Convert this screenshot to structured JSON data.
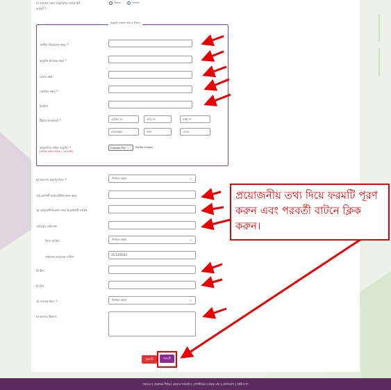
{
  "colors": {
    "accent": "#8c3b94",
    "annotation": "#e60000",
    "footer": "#5c2a5f",
    "prev_button": "#e0303b",
    "next_button": "#8b2c8f"
  },
  "question": {
    "label": "ঢ) বর্তমানে কোন অনুমতিপত্র আছে কি?",
    "label_cont": "আছে? *",
    "options": [
      "নিবন্ধন",
      "প্রযোজ্য"
    ],
    "selected_index": 1
  },
  "fieldset": {
    "legend": "অনুমতি সংক্রান্ত তথ্য ও ঠিকানা",
    "fields": [
      {
        "label": "জাতীয় পরিচয়পত্র নম্বর: *",
        "value": ""
      },
      {
        "label": "অনুমতি প্রদানের নম্বর: *",
        "value": ""
      },
      {
        "label": "রেফার নম্বর:",
        "value": ""
      },
      {
        "label": "মোবাইল নম্বর: *",
        "value": ""
      },
      {
        "label": "ইমেইল:",
        "value": ""
      }
    ],
    "address": {
      "label": "ঠিকানা (বর্তমান): *",
      "placeholders": [
        "হোল্ডিং নং",
        "বাড়ি নং",
        "রাস্তা নং",
        "গ্রাম/মহল্লা",
        "থানা",
        "জেলা"
      ]
    },
    "file": {
      "label": "অনুমোদিত ফাইল সংযুক্তি: *",
      "note": "(সর্বোচ্চ ফাইল সাইজ ২ মেগাবাইট)",
      "button": "Choose File",
      "status": "No file chosen"
    }
  },
  "lower_fields": [
    {
      "label": "ছ) আবেদন গ্রহণের ধরন: *",
      "type": "select",
      "value": "নির্বাচন করুন"
    },
    {
      "label": "জ) প্রোপার্টি আইডেন্টিফিকেশন নম্বর:",
      "type": "input",
      "value": ""
    },
    {
      "label": "ঝ) আইডেন্টিফিকেশন নম্বর উল্লেখকারী তারিখ:",
      "type": "input",
      "value": ""
    },
    {
      "label": "ঞ) ট্রেড লাইসেন্স:",
      "type": "input",
      "value": ""
    },
    {
      "label": "উৎস তারিখ:",
      "type": "select",
      "value": "নির্বাচন করুন"
    },
    {
      "label": "লাইসেন্স নবায়নের তারিখ:",
      "type": "input",
      "value": "31/12/2022"
    },
    {
      "label": "ট) টিন:",
      "type": "input",
      "value": ""
    },
    {
      "label": "ঠ) বিন:",
      "type": "input",
      "value": ""
    },
    {
      "label": "ড) ব্যবসার ধরন: *",
      "type": "select",
      "value": "নির্বাচন করুন"
    },
    {
      "label": "ঢ) ব্যবসার ঠিকানা:",
      "type": "textarea",
      "value": ""
    }
  ],
  "buttons": {
    "prev": "পূর্ববর্তী",
    "next": "পরবর্তী"
  },
  "annotation": {
    "text": "প্রয়োজনীয় তথ্য দিয়ে ফরমটি পূরণ করুন এবং পরবর্তী বাটনে ক্লিক করুন।"
  },
  "footer": {
    "links": "সহায়তা | প্রশ্নোত্তর শীর্ষক | ব্যবহার শর্তাবলি | গোপনীয়তা | প্রকল্প তথ্য | যোগাযোগ | সাইট ম্যাপ"
  }
}
